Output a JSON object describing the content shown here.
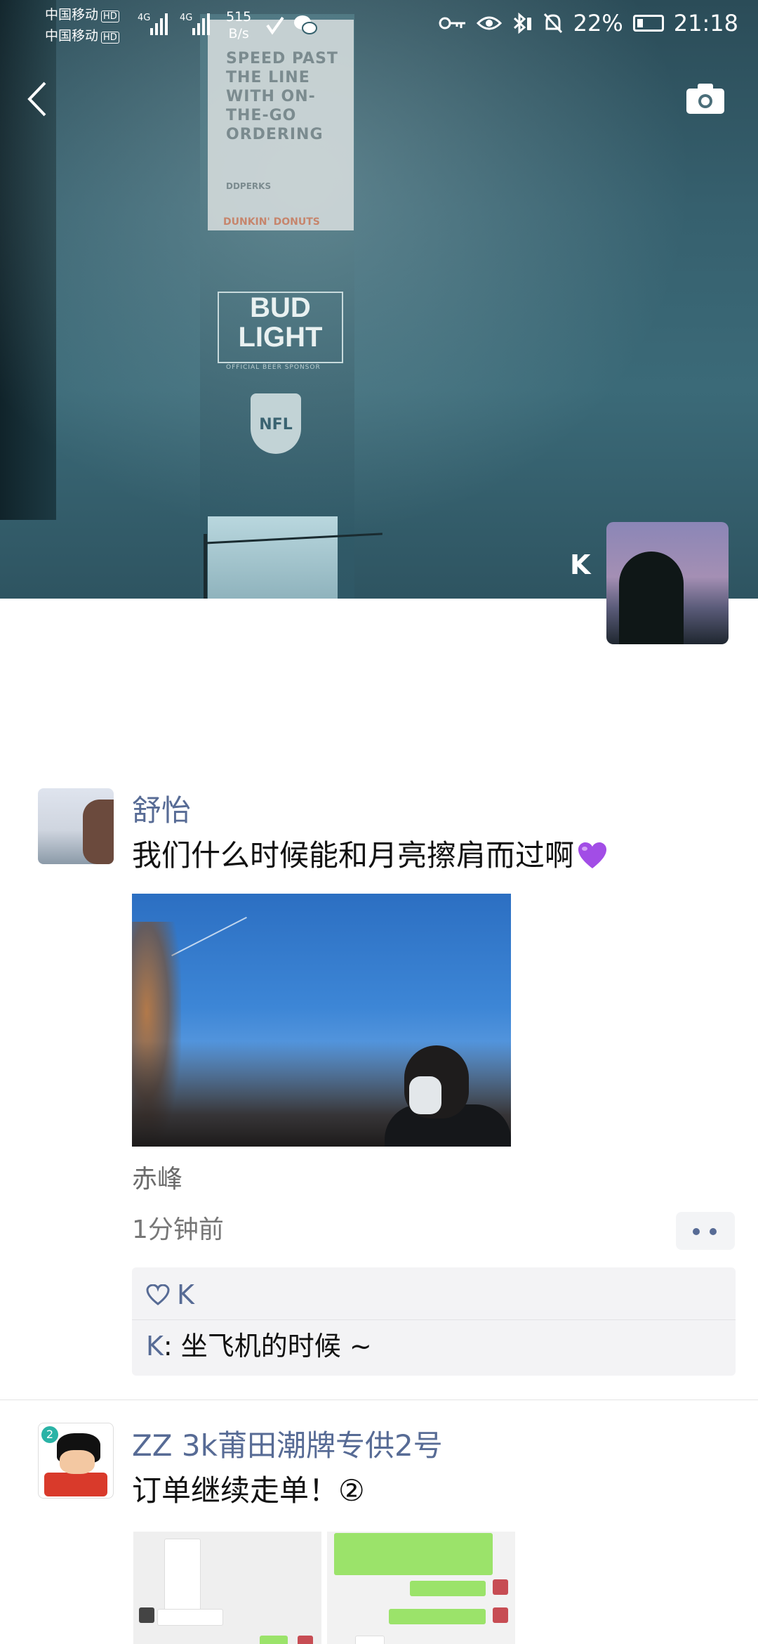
{
  "status_bar": {
    "carrier1": "中国移动",
    "carrier2": "中国移动",
    "hd": "HD",
    "network1": "4G",
    "network2": "4G",
    "net_speed_value": "515",
    "net_speed_unit": "B/s",
    "battery_percent": "22%",
    "time": "21:18"
  },
  "cover": {
    "billboard_text": "SPEED PAST THE LINE WITH ON-THE-GO ORDERING",
    "billboard_sub": "DDPERKS",
    "billboard_brand": "DUNKIN' DONUTS",
    "bud_light": "BUD LIGHT",
    "bud_sub": "OFFICIAL BEER SPONSOR",
    "nfl": "NFL"
  },
  "profile": {
    "name": "K"
  },
  "posts": [
    {
      "author": "舒怡",
      "text": "我们什么时候能和月亮擦肩而过啊",
      "location": "赤峰",
      "time": "1分钟前",
      "likes": [
        "K"
      ],
      "comments": [
        {
          "author": "K",
          "text": ": 坐飞机的时候 ~"
        }
      ]
    },
    {
      "author": "ZZ 3k莆田潮牌专供2号",
      "text": "订单继续走单！②",
      "avatar_badge": "2"
    }
  ],
  "icons": [
    "back-icon",
    "camera-icon",
    "key-icon",
    "eye-icon",
    "bluetooth-icon",
    "mute-bell-icon",
    "battery-icon",
    "purple-heart-emoji",
    "heart-outline-icon",
    "more-dots-icon"
  ],
  "colors": {
    "link_blue": "#576b95",
    "comment_bg": "#f3f3f5",
    "purple_heart": "#a24de6"
  }
}
